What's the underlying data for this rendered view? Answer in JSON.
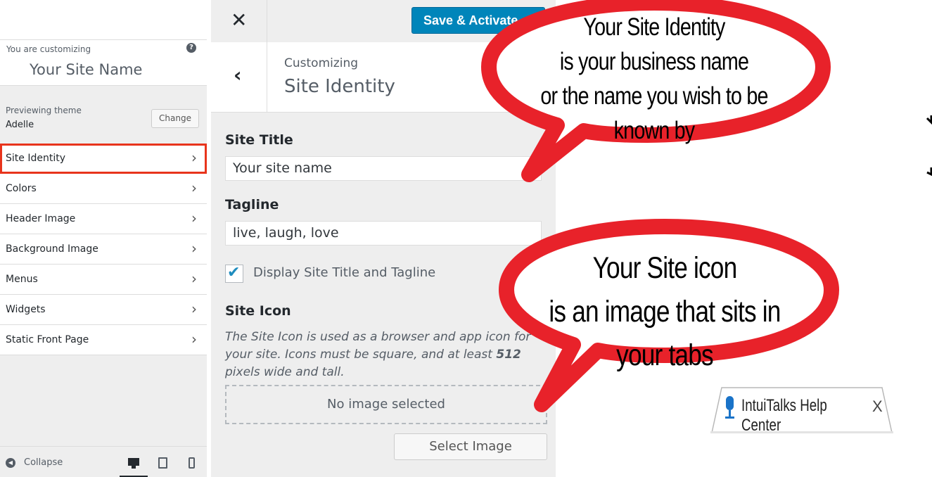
{
  "header": {
    "close_glyph": "✕",
    "save_button_label": "Save & Activate"
  },
  "sidebar": {
    "customizing_label": "You are customizing",
    "help_glyph": "?",
    "site_name": "Your Site Name",
    "previewing_label": "Previewing theme",
    "theme_name": "Adelle",
    "change_button": "Change",
    "items": [
      {
        "label": "Site Identity",
        "active": true
      },
      {
        "label": "Colors"
      },
      {
        "label": "Header Image"
      },
      {
        "label": "Background Image"
      },
      {
        "label": "Menus"
      },
      {
        "label": "Widgets"
      },
      {
        "label": "Static Front Page"
      }
    ],
    "chevron_glyph": "›",
    "collapse_label": "Collapse"
  },
  "section": {
    "crumb": "Customizing",
    "title": "Site Identity",
    "site_title_label": "Site Title",
    "site_title_value": "Your site name",
    "tagline_label": "Tagline",
    "tagline_value": "live, laugh, love",
    "display_checkbox_label": "Display Site Title and Tagline",
    "display_checked": true,
    "site_icon_label": "Site Icon",
    "site_icon_desc_part1": "The Site Icon is used as a browser and app icon for your site. Icons must be square, and at least ",
    "site_icon_desc_bold": "512",
    "site_icon_desc_part2": " pixels wide and tall.",
    "no_image_text": "No image selected",
    "select_image_button": "Select Image"
  },
  "callouts": {
    "bubble1_lines": [
      "Your Site Identity",
      "is your business name",
      "or the name you wish to be known by"
    ],
    "bubble2_lines": [
      "Your Site icon",
      "is an image that sits in your tabs"
    ],
    "bubble_color": "#e8222a"
  },
  "tab_example": {
    "title": "IntuiTalks Help Center",
    "close_glyph": "X"
  },
  "colors": {
    "accent": "#0085ba",
    "highlight_border": "#e8341c",
    "panel_bg": "#eeeeee"
  }
}
